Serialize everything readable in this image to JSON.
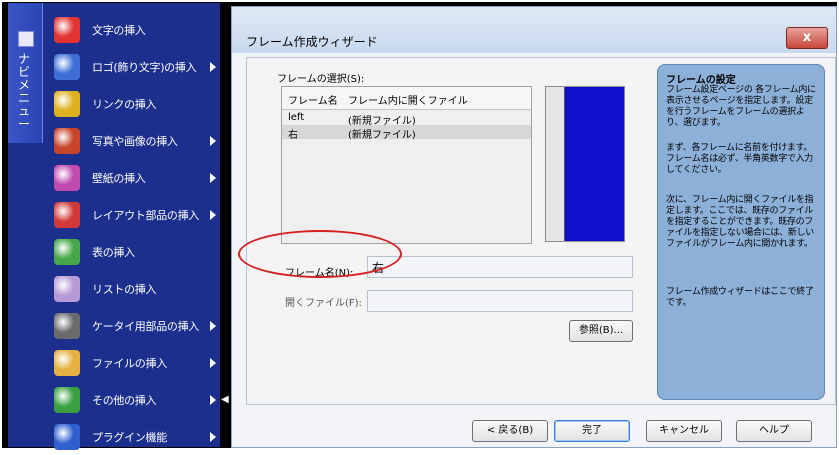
{
  "sidebar": {
    "tab_label": "ナビメニュー",
    "items": [
      {
        "label": "文字の挿入",
        "icon": "letter-a-icon",
        "color": "#e23434",
        "submenu": false
      },
      {
        "label": "ロゴ(飾り文字)の挿入",
        "icon": "logo-icon",
        "color": "#3f6fd6",
        "submenu": true
      },
      {
        "label": "リンクの挿入",
        "icon": "link-rings-icon",
        "color": "#e0b020",
        "submenu": false
      },
      {
        "label": "写真や画像の挿入",
        "icon": "picture-icon",
        "color": "#c8442a",
        "submenu": true
      },
      {
        "label": "壁紙の挿入",
        "icon": "wallpaper-icon",
        "color": "#c04ab0",
        "submenu": true
      },
      {
        "label": "レイアウト部品の挿入",
        "icon": "layout-parts-icon",
        "color": "#d23a3a",
        "submenu": true
      },
      {
        "label": "表の挿入",
        "icon": "table-icon",
        "color": "#46a84a",
        "submenu": false
      },
      {
        "label": "リストの挿入",
        "icon": "list-icon",
        "color": "#b69ad6",
        "submenu": false
      },
      {
        "label": "ケータイ用部品の挿入",
        "icon": "mobile-phone-icon",
        "color": "#6b6b6b",
        "submenu": true
      },
      {
        "label": "ファイルの挿入",
        "icon": "folder-icon",
        "color": "#e6b040",
        "submenu": true
      },
      {
        "label": "その他の挿入",
        "icon": "shapes-icon",
        "color": "#3aa040",
        "submenu": true
      },
      {
        "label": "プラグイン機能",
        "icon": "plus-icon",
        "color": "#3060d0",
        "submenu": true
      }
    ]
  },
  "dialog": {
    "title": "フレーム作成ウィザード",
    "close_label": "x",
    "frame_select_label": "フレームの選択(S):",
    "list_headers": [
      "フレーム名",
      "フレーム内に開くファイル"
    ],
    "rows": [
      {
        "name": "left",
        "file": "(新規ファイル)",
        "selected": false
      },
      {
        "name": "右",
        "file": "(新規ファイル)",
        "selected": true
      }
    ],
    "frame_name_label": "フレーム名(N):",
    "frame_name_value": "右",
    "open_file_label": "開くファイル(F):",
    "open_file_value": "",
    "browse_label": "参照(B)...",
    "help": {
      "title": "フレームの設定",
      "p1": "フレーム設定ページの 各フレーム内に表示させるページを指定します。設定を行うフレームをフレームの選択より、選びます。",
      "p2": "まず、各フレームに名前を付けます。フレーム名は必ず、半角英数字で入力してください。",
      "p3": "次に、フレーム内に開くファイルを指定します。ここでは、既存のファイルを指定することができます。既存のファイルを指定しない場合には、新しいファイルがフレーム内に開かれます。",
      "p4": "フレーム作成ウィザードはここで終了です。"
    },
    "buttons": {
      "back": "< 戻る(B)",
      "finish": "完了",
      "cancel": "キャンセル",
      "help": "ヘルプ"
    }
  },
  "colors": {
    "sidebar_bg": "#1c2f8c",
    "highlight_ellipse": "#d42020",
    "preview_frame": "#1010d0",
    "help_panel": "#8db0d8"
  }
}
